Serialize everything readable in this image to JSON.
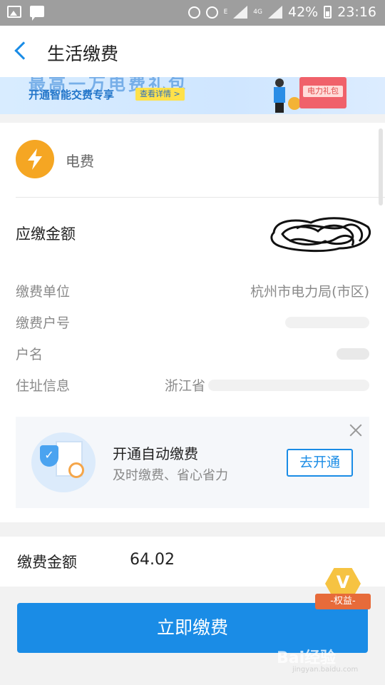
{
  "status_bar": {
    "battery": "42%",
    "time": "23:16",
    "network": "4G",
    "sim_indicator": "E"
  },
  "header": {
    "title": "生活缴费",
    "back_icon": "chevron-left-icon"
  },
  "banner": {
    "headline": "最高一万电费礼包",
    "subtitle": "开通智能交费专享",
    "button_label": "查看详情 >",
    "gift_label": "电力礼包"
  },
  "bill": {
    "type_label": "电费",
    "type_icon": "lightning-bolt-icon",
    "type_icon_color": "#f5a623",
    "amount_due_label": "应缴金额",
    "amount_due_value": "",
    "info": [
      {
        "label": "缴费单位",
        "value": "杭州市电力局(市区)"
      },
      {
        "label": "缴费户号",
        "value": ""
      },
      {
        "label": "户名",
        "value": ""
      },
      {
        "label": "住址信息",
        "value": "浙江省"
      }
    ]
  },
  "auto_pay": {
    "title": "开通自动缴费",
    "subtitle": "及时缴费、省心省力",
    "button_label": "去开通",
    "close_icon": "close-icon"
  },
  "payment": {
    "label": "缴费金额",
    "value": "64.02"
  },
  "submit": {
    "label": "立即缴费",
    "color": "#1a8ce6"
  },
  "rights_badge": {
    "label": "-权益-"
  },
  "watermark": {
    "text": "Bai经验",
    "sub": "jingyan.baidu.com"
  }
}
